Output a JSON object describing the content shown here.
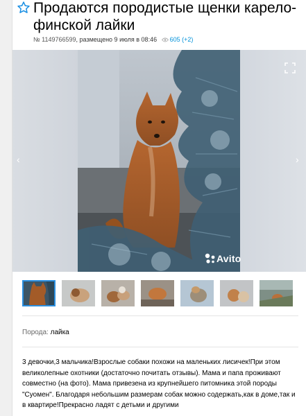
{
  "listing": {
    "title": "Продаются породистые щенки карело-финской лайки",
    "number": "№ 1149766599",
    "posted": ", размещено 9 июля в 08:46",
    "views": "605 (+2)"
  },
  "gallery": {
    "watermark": "Avito",
    "photo_count": 7,
    "active_index": 0
  },
  "params": {
    "breed_label": "Порода:",
    "breed_value": "лайка"
  },
  "description": "3 девочки,3 мальчика!Взрослые собаки похожи на маленьких лисичек!При этом великолепные охотники (достаточно почитать отзывы). Мама и папа проживают совместно (на фото). Мама привезена из крупнейшего питомника этой породы \"Суомен\". Благодаря небольшим размерам собак можно содержать,как в доме,так и в квартире!Прекрасно ладят с детьми и другими",
  "colors": {
    "accent": "#0091d9",
    "active_thumb": "#2a8fe0"
  }
}
